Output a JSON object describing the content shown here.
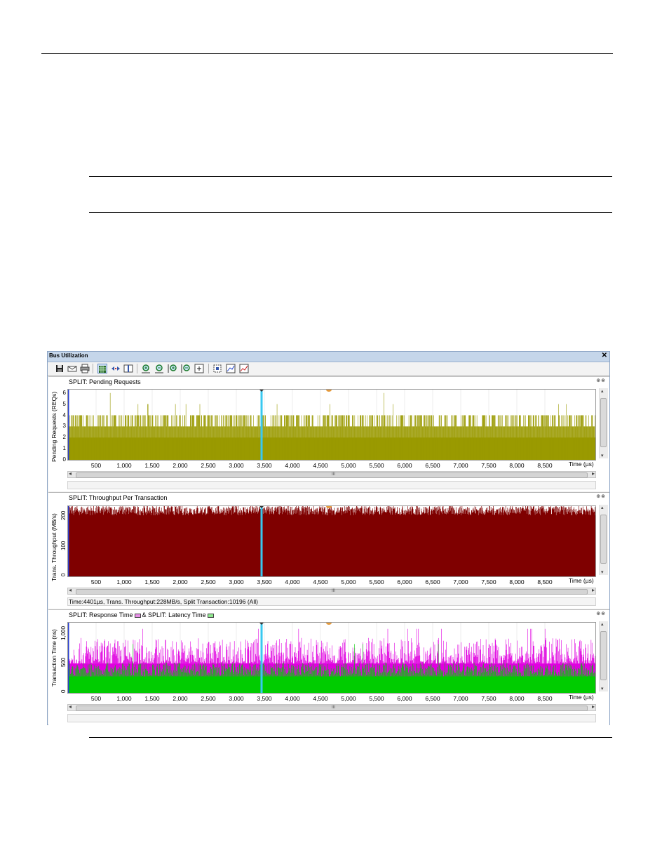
{
  "window": {
    "title": "Bus Utilization",
    "close_label": "✕"
  },
  "toolbar": {
    "icons": [
      "save-icon",
      "email-icon",
      "print-icon",
      "grid-view-icon",
      "sync-icon",
      "split-view-icon",
      "zoom-in-horizontal-icon",
      "zoom-out-horizontal-icon",
      "zoom-in-vertical-icon",
      "zoom-out-vertical-icon",
      "fit-icon",
      "select-region-icon",
      "graph-settings-icon",
      "chart-options-icon"
    ]
  },
  "x_axis": {
    "ticks": [
      "500",
      "1,000",
      "1,500",
      "2,000",
      "2,500",
      "3,000",
      "3,500",
      "4,000",
      "4,500",
      "5,000",
      "5,500",
      "6,000",
      "6,500",
      "7,000",
      "7,500",
      "8,000",
      "8,500"
    ],
    "unit": "Time (µs)"
  },
  "panels": [
    {
      "title": "SPLIT: Pending Requests",
      "ylabel": "Pending Requests (REQs)",
      "yticks": [
        "0",
        "1",
        "2",
        "3",
        "4",
        "5",
        "6"
      ],
      "status": "",
      "color": "#9a9a00"
    },
    {
      "title": "SPLIT: Throughput Per Transaction",
      "ylabel": "Trans. Throughput (MB/s)",
      "yticks": [
        "0",
        "100",
        "200"
      ],
      "status": "Time:4401µs, Trans. Throughput:228MB/s, Split Transaction:10196 (All)",
      "color": "#7f0000"
    },
    {
      "title_a": "SPLIT: Response Time",
      "title_b": "& SPLIT: Latency Time",
      "ylabel": "Transaction Time (ns)",
      "yticks": [
        "0",
        "500",
        "1,000"
      ],
      "status": "",
      "color_response": "#e000e0",
      "color_latency": "#00cc00"
    }
  ],
  "chart_data": [
    {
      "type": "bar",
      "title": "SPLIT: Pending Requests",
      "ylabel": "Pending Requests (REQs)",
      "xlabel": "Time (µs)",
      "xlim": [
        0,
        9400
      ],
      "ylim": [
        0,
        6.3
      ],
      "baseline_value": 2,
      "typical_peak": 4,
      "max_value": 6,
      "series": [
        {
          "values": [
            2,
            3,
            4,
            5,
            6
          ]
        }
      ]
    },
    {
      "type": "bar",
      "title": "SPLIT: Throughput Per Transaction",
      "ylabel": "Trans. Throughput (MB/s)",
      "xlabel": "Time (µs)",
      "xlim": [
        0,
        9400
      ],
      "ylim": [
        0,
        230
      ],
      "typical_range": [
        200,
        232
      ]
    },
    {
      "type": "bar",
      "title": "SPLIT: Response Time & SPLIT: Latency Time",
      "ylabel": "Transaction Time (ns)",
      "xlabel": "Time (µs)",
      "xlim": [
        0,
        9400
      ],
      "ylim": [
        0,
        1150
      ],
      "series": [
        {
          "name": "SPLIT: Response Time",
          "typical_range": [
            480,
            900
          ]
        },
        {
          "name": "SPLIT: Latency Time",
          "typical_range": [
            270,
            500
          ]
        }
      ]
    }
  ],
  "markers": {
    "cursor_time": "3,450",
    "marker_time": "4,650"
  }
}
